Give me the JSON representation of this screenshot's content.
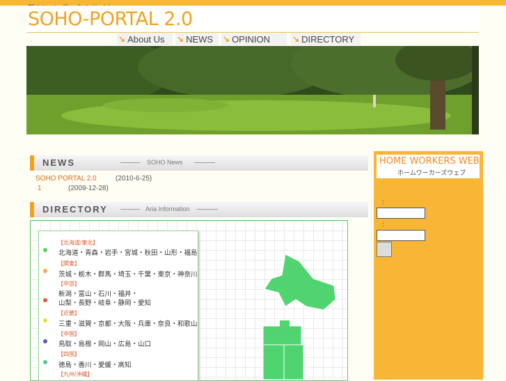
{
  "header": {
    "tagline": "新SOHO ポータルサイト",
    "logo": "SOHO-PORTAL 2.0"
  },
  "nav": [
    {
      "label": "About Us"
    },
    {
      "label": "NEWS"
    },
    {
      "label": "OPINION"
    },
    {
      "label": "DIRECTORY"
    }
  ],
  "news": {
    "title": "NEWS",
    "subtitle": "SOHO News",
    "items": [
      {
        "text": "SOHO PORTAL 2.0",
        "date": "(2010-6-25)"
      },
      {
        "text": "1",
        "date": "(2009-12-28)"
      }
    ]
  },
  "directory": {
    "title": "DIRECTORY",
    "subtitle": "Aria Information",
    "regions": [
      {
        "head": "【北海道/東北】",
        "lines": [
          "北海道・青森・岩手・宮城・秋田・山形・福島"
        ],
        "color": "#5fcc5f"
      },
      {
        "head": "【関東】",
        "lines": [
          "茨城・栃木・群馬・埼玉・千葉・東京・神奈川"
        ],
        "color": "#f6a64a"
      },
      {
        "head": "【中部】",
        "lines": [
          "新潟・富山・石川・福井・",
          "山梨・長野・岐阜・静岡・愛知"
        ],
        "color": "#e05a3a"
      },
      {
        "head": "【近畿】",
        "lines": [
          "三重・滋賀・京都・大阪・兵庫・奈良・和歌山"
        ],
        "color": "#e8e03a"
      },
      {
        "head": "【中国】",
        "lines": [
          "鳥取・島根・岡山・広島・山口"
        ],
        "color": "#6a52b8"
      },
      {
        "head": "【四国】",
        "lines": [
          "徳島・香川・愛媛・高知"
        ],
        "color": "#5fbf8f"
      },
      {
        "head": "【九州/沖縄】",
        "lines": [],
        "color": "#5fcc5f"
      }
    ]
  },
  "sidebar": {
    "logo_en": "HOME WORKERS WEB",
    "logo_jp": "ホームワーカーズウェブ",
    "field1_label": ":",
    "field2_label": ":"
  },
  "colors": {
    "accent": "#f0a21c",
    "sidebar": "#f8b536",
    "map_green": "#4fd46f"
  }
}
